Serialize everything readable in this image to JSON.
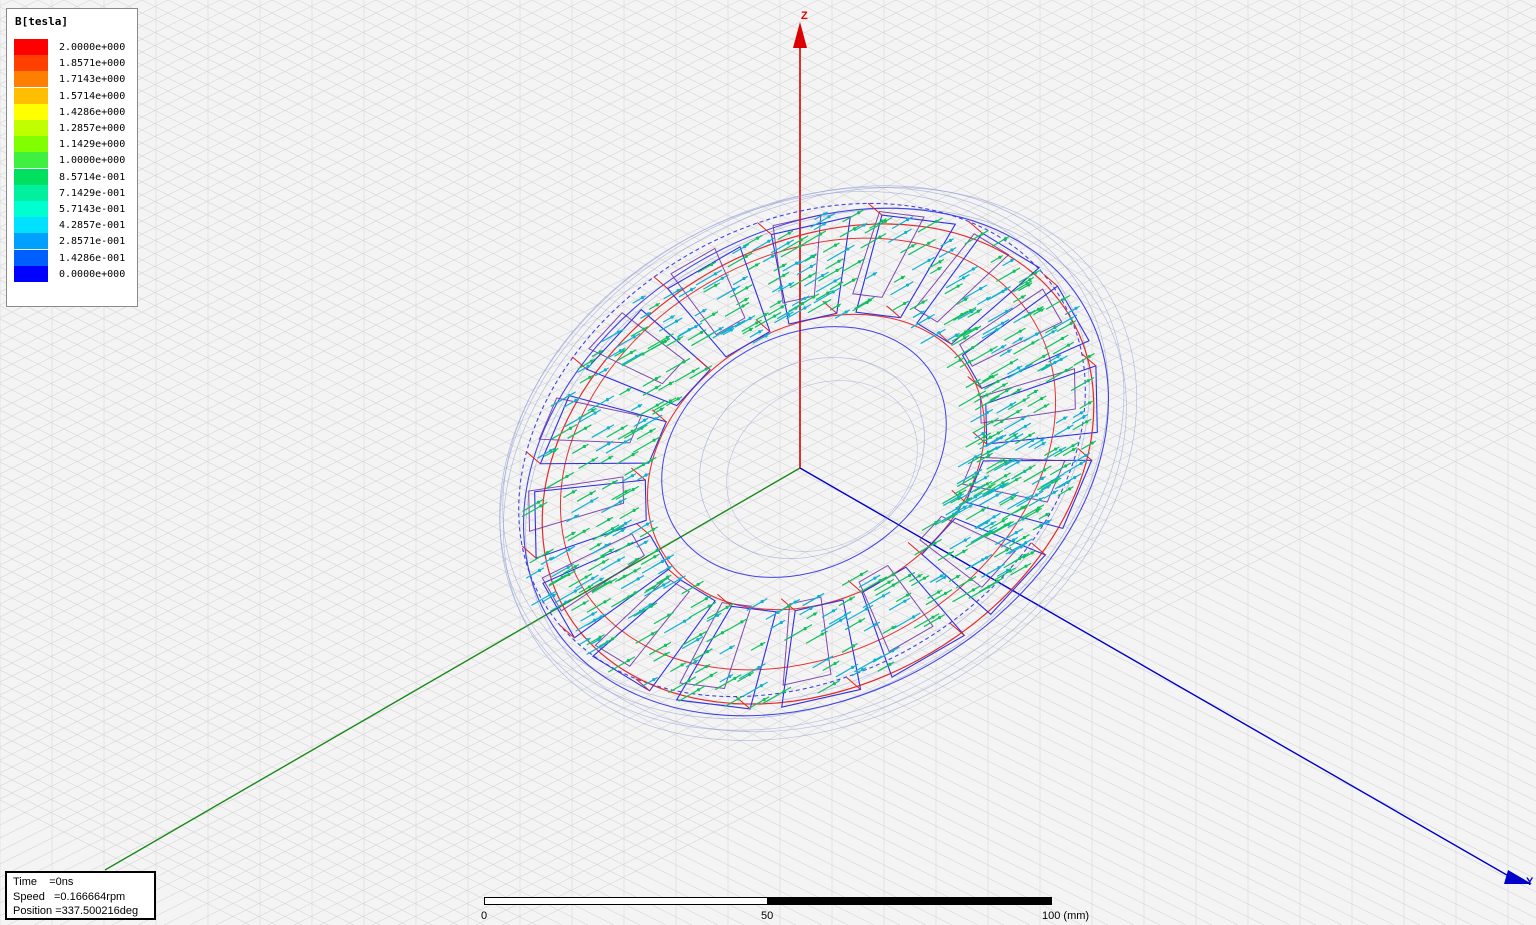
{
  "legend": {
    "title": "B[tesla]",
    "entries": [
      {
        "label": "2.0000e+000",
        "color": "#ff0000"
      },
      {
        "label": "1.8571e+000",
        "color": "#ff4000"
      },
      {
        "label": "1.7143e+000",
        "color": "#ff8000"
      },
      {
        "label": "1.5714e+000",
        "color": "#ffbf00"
      },
      {
        "label": "1.4286e+000",
        "color": "#ffff00"
      },
      {
        "label": "1.2857e+000",
        "color": "#bfff00"
      },
      {
        "label": "1.1429e+000",
        "color": "#80ff00"
      },
      {
        "label": "1.0000e+000",
        "color": "#40f040"
      },
      {
        "label": "8.5714e-001",
        "color": "#00e060"
      },
      {
        "label": "7.1429e-001",
        "color": "#00f0a0"
      },
      {
        "label": "5.7143e-001",
        "color": "#00ffd0"
      },
      {
        "label": "4.2857e-001",
        "color": "#00e0ff"
      },
      {
        "label": "2.8571e-001",
        "color": "#00a0ff"
      },
      {
        "label": "1.4286e-001",
        "color": "#0060ff"
      },
      {
        "label": "0.0000e+000",
        "color": "#0000ff"
      }
    ]
  },
  "info": {
    "time": "Time    =0ns",
    "speed": "Speed   =0.166664rpm",
    "position": "Position =337.500216deg"
  },
  "scale": {
    "label_0": "0",
    "label_50": "50",
    "label_100": "100 (mm)"
  },
  "axes": {
    "z": "Z",
    "y": "Y"
  },
  "colors": {
    "background": "#f4f4f4",
    "grid": "#d8d8d8",
    "axis_x": "#1a8a1a",
    "axis_y": "#0000cc",
    "axis_z": "#dd0000",
    "stator_outline": "#3030e0",
    "magnet_outline": "#e02020",
    "arrow_green": "#10c060",
    "arrow_cyan": "#10b0d0"
  }
}
